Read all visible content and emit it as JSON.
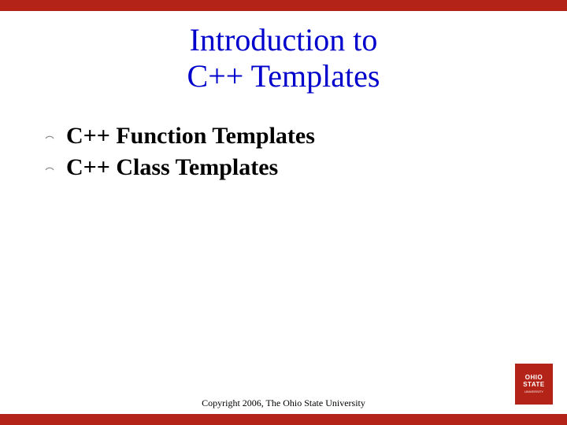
{
  "title_line1": "Introduction to",
  "title_line2": "C++ Templates",
  "bullets": {
    "item0": "C++ Function Templates",
    "item1": "C++ Class Templates"
  },
  "copyright": "Copyright 2006, The Ohio State University",
  "logo": {
    "line1": "OHIO",
    "line2": "STATE",
    "sub": "UNIVERSITY"
  },
  "colors": {
    "accent": "#b32317",
    "title": "#0000cc"
  }
}
